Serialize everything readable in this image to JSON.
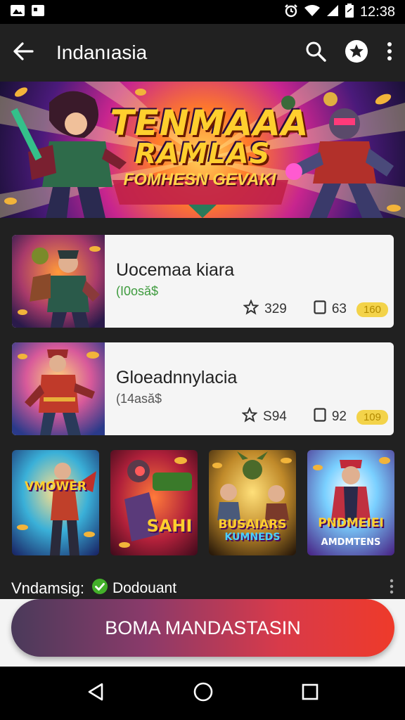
{
  "status_bar": {
    "time": "12:38",
    "icons": [
      "photo-icon",
      "image-icon",
      "alarm-icon",
      "wifi-icon",
      "signal-icon",
      "battery-icon"
    ]
  },
  "app_bar": {
    "title": "Indanıasia",
    "icons": [
      "back-arrow-icon",
      "search-icon",
      "star-circle-icon",
      "more-vert-icon"
    ]
  },
  "banner": {
    "title_line1": "TENMAAA",
    "title_line2": "RAMLAS",
    "subtitle": "FOMHESN GEVAKI"
  },
  "cards": [
    {
      "title": "Uocemaa kiara",
      "price": "(I0osă$",
      "rating": "329",
      "count": "63",
      "pill": "160"
    },
    {
      "title": "Gloeadnnylacia",
      "price": "(14asă$",
      "rating": "S94",
      "count": "92",
      "pill": "109"
    }
  ],
  "tiles": [
    {
      "label": "VMOWER"
    },
    {
      "label": "SAHI"
    },
    {
      "label": "BUSAIARS"
    },
    {
      "label": "PNDMEIEI"
    }
  ],
  "tile_sublabels": [
    {
      "label": "KUMNEDS"
    },
    {
      "label": "AMDMTENS"
    }
  ],
  "footer": {
    "label": "Vndamsig:",
    "status": "Dodouant"
  },
  "cta": {
    "label": "BOMA MANDASTASIN"
  },
  "colors": {
    "app_bg": "#212121",
    "card_bg": "#f5f5f5",
    "price_green": "#3e9b3e",
    "pill_yellow": "#f3d34a",
    "cta_start": "#4a3a5a",
    "cta_end": "#ee3a2a",
    "check_green": "#43b02a"
  }
}
